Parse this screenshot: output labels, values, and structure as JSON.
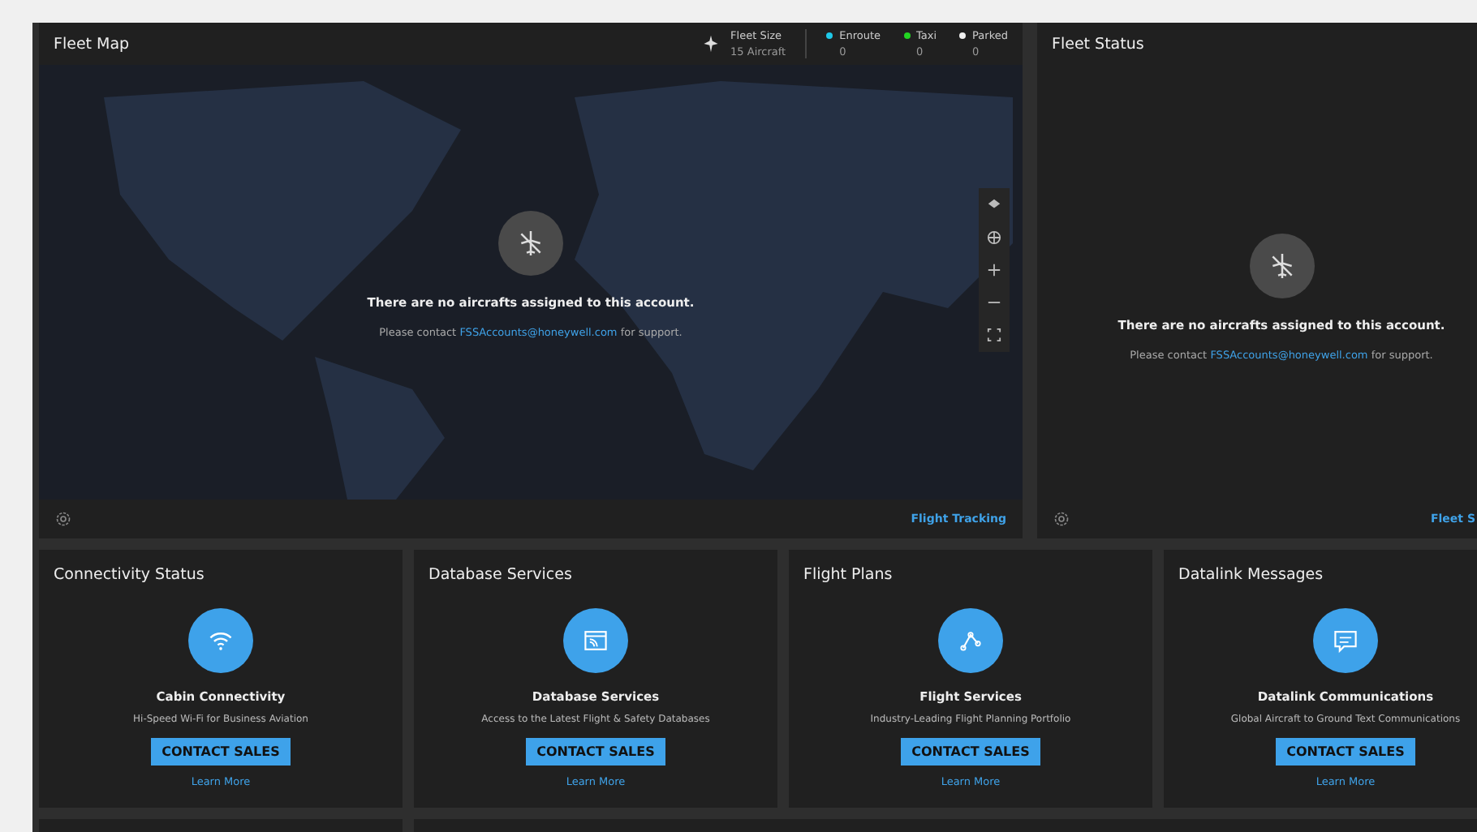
{
  "fleet_map": {
    "title": "Fleet Map",
    "fleet_size": {
      "label": "Fleet Size",
      "value": "15 Aircraft"
    },
    "legend": [
      {
        "label": "Enroute",
        "count": "0",
        "color": "#1ec8e8"
      },
      {
        "label": "Taxi",
        "count": "0",
        "color": "#22d422"
      },
      {
        "label": "Parked",
        "count": "0",
        "color": "#f0f0f0"
      }
    ],
    "empty_message": "There are no aircrafts assigned to this account.",
    "contact_prefix": "Please contact",
    "contact_email": "FSSAccounts@honeywell.com",
    "contact_suffix": "for support.",
    "footer_link": "Flight Tracking"
  },
  "fleet_status": {
    "title": "Fleet Status",
    "empty_message": "There are no aircrafts assigned to this account.",
    "contact_prefix": "Please contact",
    "contact_email": "FSSAccounts@honeywell.com",
    "contact_suffix": "for support.",
    "footer_link": "Fleet S"
  },
  "cards": [
    {
      "title": "Connectivity Status",
      "kind": "wifi",
      "heading": "Cabin Connectivity",
      "description": "Hi-Speed Wi-Fi for Business Aviation",
      "button": "CONTACT SALES",
      "link": "Learn More"
    },
    {
      "title": "Database Services",
      "kind": "database",
      "heading": "Database Services",
      "description": "Access to the Latest Flight & Safety Databases",
      "button": "CONTACT SALES",
      "link": "Learn More"
    },
    {
      "title": "Flight Plans",
      "kind": "route",
      "heading": "Flight Services",
      "description": "Industry-Leading Flight Planning Portfolio",
      "button": "CONTACT SALES",
      "link": "Learn More"
    },
    {
      "title": "Datalink Messages",
      "kind": "message",
      "heading": "Datalink Communications",
      "description": "Global Aircraft to Ground Text Communications",
      "button": "CONTACT SALES",
      "link": "Learn More"
    }
  ]
}
